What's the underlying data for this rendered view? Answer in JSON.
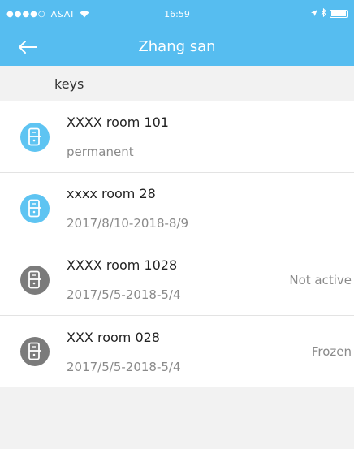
{
  "statusbar": {
    "carrier": "A&AT",
    "time": "16:59"
  },
  "navbar": {
    "title": "Zhang san"
  },
  "section": {
    "title": "keys"
  },
  "keys": [
    {
      "name": "XXXX room 101",
      "validity": "permanent",
      "status": "",
      "icon_color": "#5ec4f2"
    },
    {
      "name": "xxxx room 28",
      "validity": "2017/8/10-2018-8/9",
      "status": "",
      "icon_color": "#5ec4f2"
    },
    {
      "name": "XXXX room 1028",
      "validity": "2017/5/5-2018-5/4",
      "status": "Not active",
      "icon_color": "#7b7b7b"
    },
    {
      "name": "XXX room 028",
      "validity": "2017/5/5-2018-5/4",
      "status": "Frozen",
      "icon_color": "#7b7b7b"
    }
  ],
  "colors": {
    "accent": "#56bdf0",
    "background": "#f2f2f2"
  }
}
